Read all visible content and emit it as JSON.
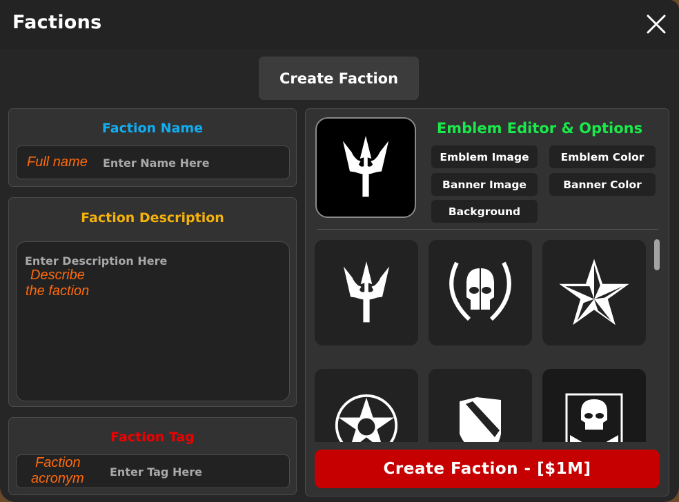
{
  "window": {
    "title": "Factions",
    "close_icon": "close-icon"
  },
  "header": {
    "create_tab_label": "Create Faction"
  },
  "name_section": {
    "title": "Faction Name",
    "title_color": "#11aef2",
    "hint": "Full name",
    "placeholder": "Enter Name Here",
    "value": ""
  },
  "description_section": {
    "title": "Faction Description",
    "title_color": "#f5b20c",
    "placeholder": "Enter Description Here",
    "hint_line1": "Describe",
    "hint_line2": "the faction",
    "value": ""
  },
  "tag_section": {
    "title": "Faction Tag",
    "title_color": "#ee0000",
    "hint_line1": "Faction",
    "hint_line2": "acronym",
    "placeholder": "Enter Tag Here",
    "value": ""
  },
  "emblem_editor": {
    "title": "Emblem Editor & Options",
    "title_color": "#19e94a",
    "preview_icon": "trident-icon",
    "options": [
      {
        "label": "Emblem Image"
      },
      {
        "label": "Emblem Color"
      },
      {
        "label": "Banner Image"
      },
      {
        "label": "Banner Color"
      },
      {
        "label": "Background"
      }
    ],
    "emblems": [
      {
        "icon": "trident-icon"
      },
      {
        "icon": "skull-icon"
      },
      {
        "icon": "nautical-star-icon"
      },
      {
        "icon": "circle-star-icon"
      },
      {
        "icon": "shield-icon"
      },
      {
        "icon": "skull-chevron-icon"
      }
    ]
  },
  "footer": {
    "create_button_label": "Create Faction - [$1M]",
    "accent": "#c60000"
  }
}
